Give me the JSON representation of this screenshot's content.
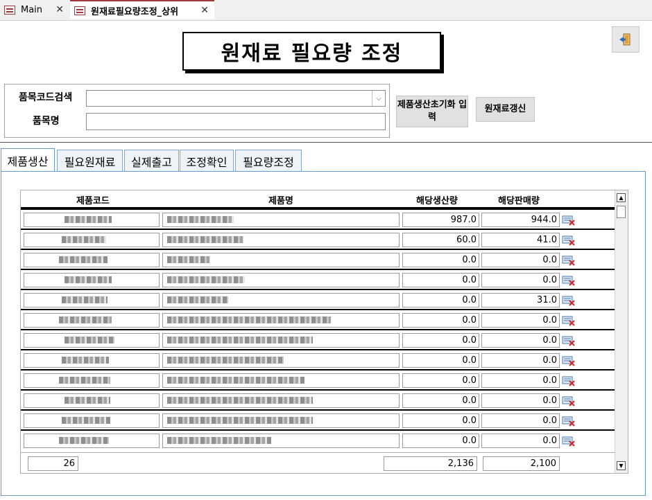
{
  "doc_tabs": [
    {
      "label": "Main"
    },
    {
      "label": "원재료필요량조정_상위"
    }
  ],
  "title": "원재료 필요량 조정",
  "search": {
    "code_label": "품목코드검색",
    "name_label": "품목명",
    "code_value": "",
    "name_value": ""
  },
  "buttons": {
    "init_production": "제품생산초기화 입력",
    "update_material": "원재료갱신"
  },
  "tabs": [
    "제품생산",
    "필요원재료",
    "실제출고",
    "조정확인",
    "필요량조정"
  ],
  "table": {
    "headers": [
      "제품코드",
      "제품명",
      "해당생산량",
      "해당판매량"
    ],
    "rows": [
      {
        "production": "987.0",
        "sales": "944.0"
      },
      {
        "production": "60.0",
        "sales": "41.0"
      },
      {
        "production": "0.0",
        "sales": "0.0"
      },
      {
        "production": "0.0",
        "sales": "0.0"
      },
      {
        "production": "0.0",
        "sales": "31.0"
      },
      {
        "production": "0.0",
        "sales": "0.0"
      },
      {
        "production": "0.0",
        "sales": "0.0"
      },
      {
        "production": "0.0",
        "sales": "0.0"
      },
      {
        "production": "0.0",
        "sales": "0.0"
      },
      {
        "production": "0.0",
        "sales": "0.0"
      },
      {
        "production": "0.0",
        "sales": "0.0"
      },
      {
        "production": "0.0",
        "sales": "0.0"
      }
    ],
    "footer": {
      "count": "26",
      "production_total": "2,136",
      "sales_total": "2,100"
    }
  },
  "colors": {
    "accent": "#a4373a",
    "tab_border": "#6a98c4"
  }
}
